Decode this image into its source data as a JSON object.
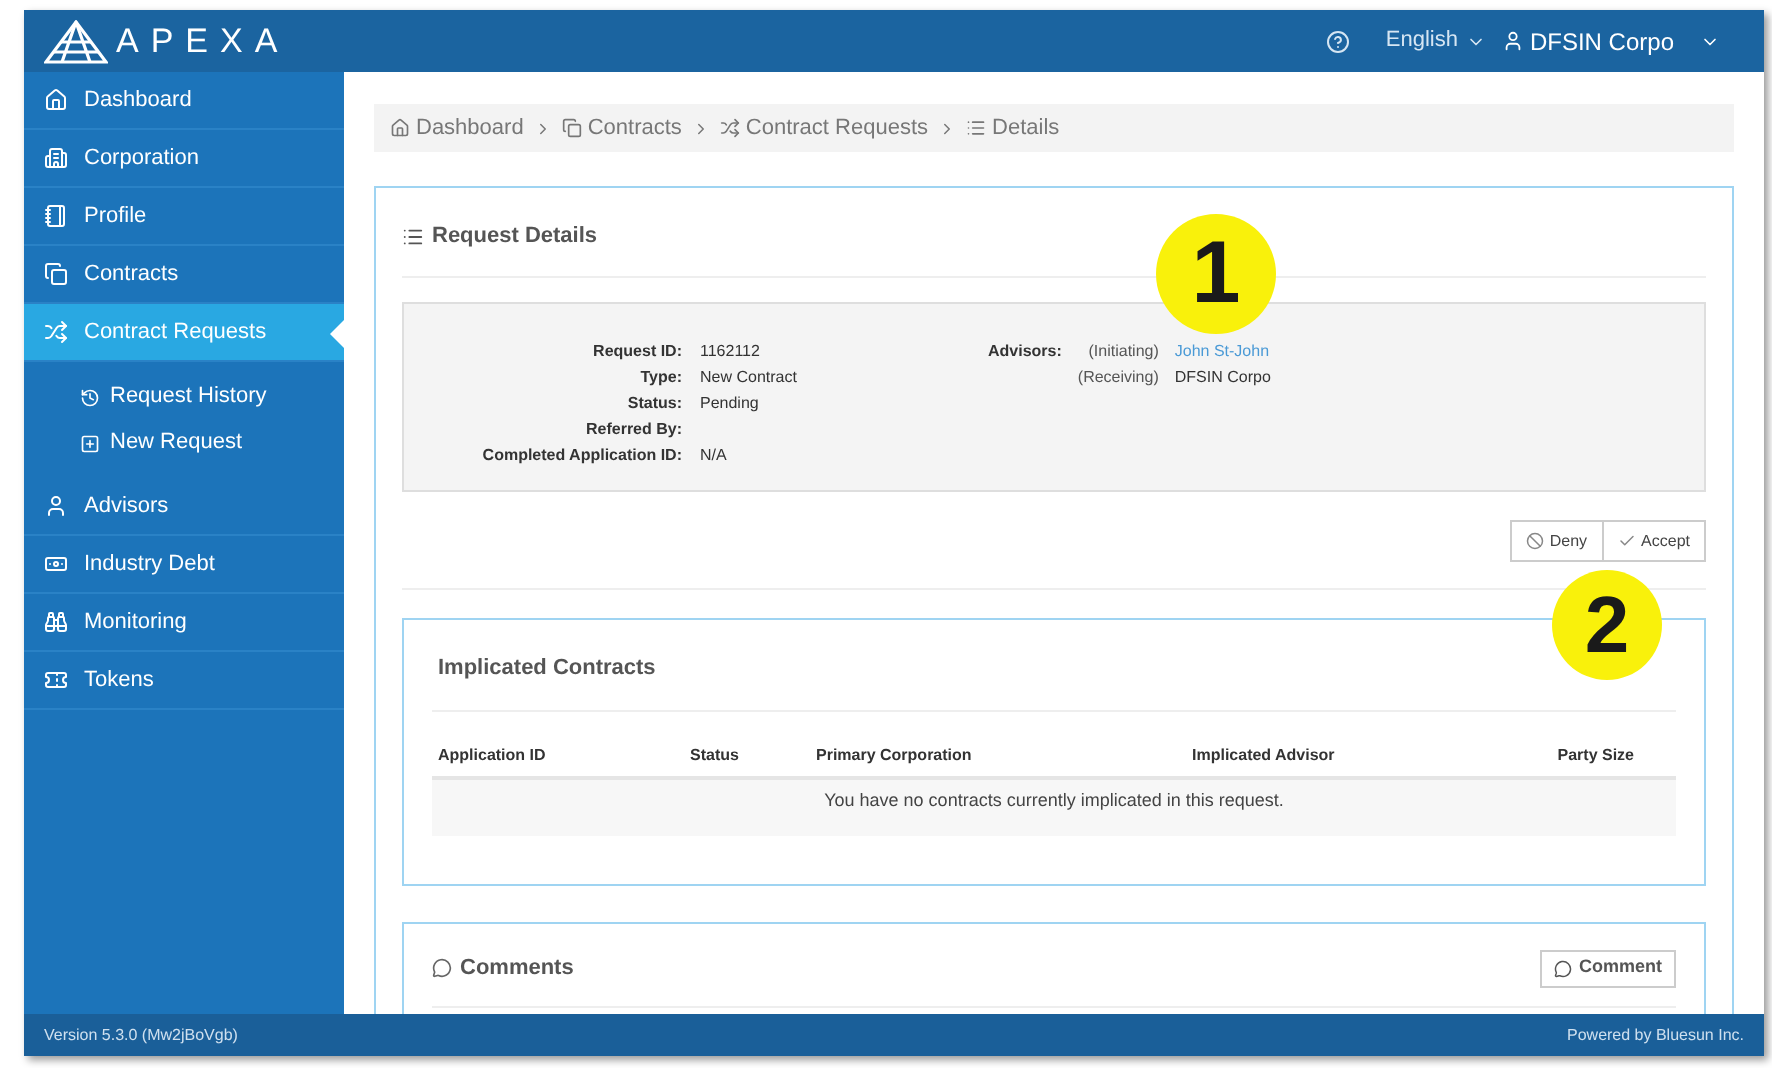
{
  "header": {
    "logo_text": "APEXA",
    "language": "English",
    "user": "DFSIN Corpo"
  },
  "sidebar": {
    "items": [
      {
        "label": "Dashboard",
        "selected": false
      },
      {
        "label": "Corporation",
        "selected": false
      },
      {
        "label": "Profile",
        "selected": false
      },
      {
        "label": "Contracts",
        "selected": false
      },
      {
        "label": "Contract Requests",
        "selected": true,
        "children": [
          {
            "label": "Request History"
          },
          {
            "label": "New Request"
          }
        ]
      },
      {
        "label": "Advisors",
        "selected": false
      },
      {
        "label": "Industry Debt",
        "selected": false
      },
      {
        "label": "Monitoring",
        "selected": false
      },
      {
        "label": "Tokens",
        "selected": false
      }
    ]
  },
  "breadcrumb": [
    "Dashboard",
    "Contracts",
    "Contract Requests",
    "Details"
  ],
  "request_details": {
    "title": "Request Details",
    "fields": [
      {
        "label": "Request ID:",
        "value": "1162112"
      },
      {
        "label": "Type:",
        "value": "New Contract"
      },
      {
        "label": "Status:",
        "value": "Pending"
      },
      {
        "label": "Referred By:"
      },
      {
        "label": "Completed Application ID:",
        "value": "N/A"
      }
    ],
    "advisors_label": "Advisors:",
    "advisors": [
      {
        "role": "(Initiating)",
        "name": "John St-John",
        "kind": "link"
      },
      {
        "role": "(Receiving)",
        "name": "DFSIN Corpo",
        "kind": "text"
      }
    ],
    "buttons": [
      "Deny",
      "Accept"
    ]
  },
  "implicated_contracts": {
    "title": "Implicated Contracts",
    "columns": [
      "Application ID",
      "Status",
      "Primary Corporation",
      "Implicated Advisor",
      "Party Size"
    ],
    "empty_message": "You have no contracts currently implicated in this request."
  },
  "comments": {
    "title": "Comments",
    "button": "Comment"
  },
  "footer": {
    "version": "Version 5.3.0 (Mw2jBoVgb)",
    "powered_by": "Powered by Bluesun Inc."
  },
  "annotations": [
    "1",
    "2"
  ]
}
